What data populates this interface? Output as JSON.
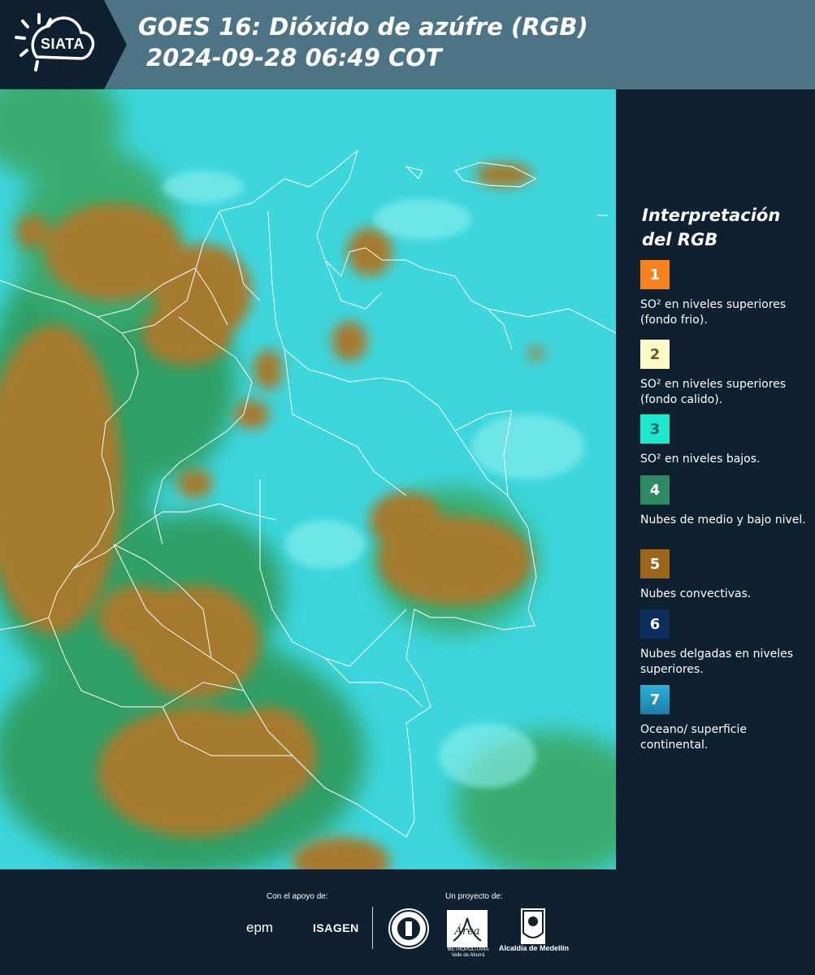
{
  "header": {
    "logo_text": "SIATA",
    "title": "GOES 16: Dióxido de azúfre (RGB)",
    "subtitle": " 2024-09-28 06:49 COT",
    "background_color": "#4c7484"
  },
  "legend": {
    "title_line1": "Interpretación",
    "title_line2": "del RGB",
    "items": [
      {
        "number": "1",
        "label": "SO² en niveles superiores (fondo frio).",
        "color": "#f5821f"
      },
      {
        "number": "2",
        "label": "SO² en niveles superiores (fondo calido).",
        "color": "#fff9c8"
      },
      {
        "number": "3",
        "label": "SO² en niveles bajos.",
        "color": "#1ee8cf"
      },
      {
        "number": "4",
        "label": "Nubes de medio y bajo nivel.",
        "color": "#2e8a60"
      },
      {
        "number": "5",
        "label": "Nubes convectivas.",
        "color": "#9c6418"
      },
      {
        "number": "6",
        "label": "Nubes delgadas en niveles superiores.",
        "color": "#0d2d5c"
      },
      {
        "number": "7",
        "label": "Oceano/ superficie continental.",
        "color": "#1e8fb8"
      }
    ]
  },
  "footer": {
    "support_label": "Con el apoyo de:",
    "project_label": "Un proyecto de:",
    "epm": "epm",
    "isagen": "ISAGEN",
    "area_text": "METROPOLITANA Valle de Aburrá",
    "area_logo_text": "Área",
    "alcaldia_text": "Alcaldía de Medellín"
  }
}
